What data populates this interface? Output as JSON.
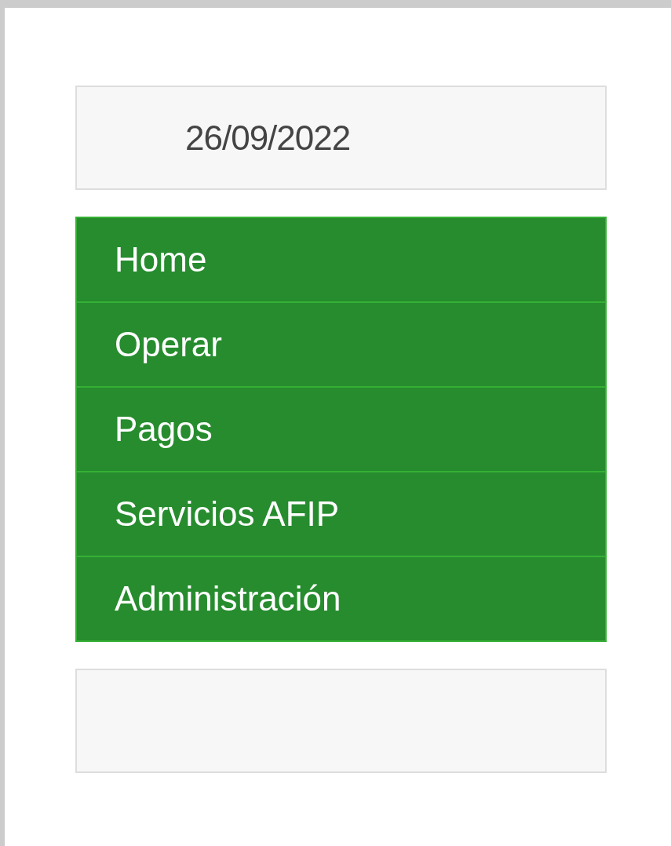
{
  "date_panel": {
    "date": "26/09/2022"
  },
  "menu": {
    "items": [
      {
        "label": "Home"
      },
      {
        "label": "Operar"
      },
      {
        "label": "Pagos"
      },
      {
        "label": "Servicios AFIP"
      },
      {
        "label": "Administración"
      }
    ]
  }
}
